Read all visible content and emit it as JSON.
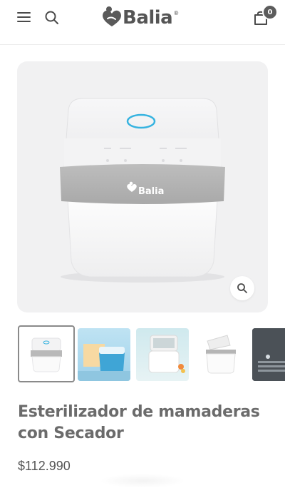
{
  "header": {
    "brand": "Balia",
    "brand_mark": "®",
    "cart_count": "0",
    "menu_icon": "hamburger-icon",
    "search_icon": "search-icon",
    "cart_icon": "cart-icon"
  },
  "product": {
    "image_brand": "Balia",
    "title": "Esterilizador de mamaderas con Secador",
    "price": "$112.990",
    "zoom_icon": "zoom-icon",
    "thumbnails_count": 5,
    "active_thumbnail": 1
  },
  "colors": {
    "text": "#6b6b6b",
    "card_bg": "#f1f1f2",
    "accent_ring": "#36b3e0",
    "badge": "#5c5c5c"
  }
}
